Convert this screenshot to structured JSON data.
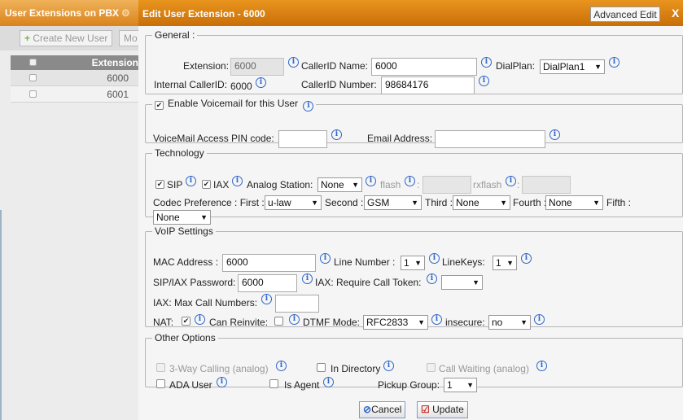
{
  "background": {
    "title": "User Extensions on PBX",
    "create_btn": "Create New User",
    "more_btn": "Mo",
    "table_header": "Extension",
    "rows": [
      "6000",
      "6001"
    ]
  },
  "modal": {
    "title": "Edit User Extension - 6000",
    "advanced_edit": "Advanced Edit",
    "close": "X"
  },
  "general": {
    "legend": "General :",
    "extension_label": "Extension:",
    "extension_value": "6000",
    "callerid_name_label": "CallerID Name:",
    "callerid_name_value": "6000",
    "dialplan_label": "DialPlan:",
    "dialplan_value": "DialPlan1",
    "internal_callerid_label": "Internal CallerID:",
    "internal_callerid_value": "6000",
    "callerid_number_label": "CallerID Number:",
    "callerid_number_value": "98684176"
  },
  "voicemail": {
    "enable_label": "Enable Voicemail for this User",
    "pin_label": "VoiceMail Access PIN code:",
    "pin_value": "",
    "email_label": "Email Address:",
    "email_value": ""
  },
  "technology": {
    "legend": "Technology",
    "sip_label": "SIP",
    "iax_label": "IAX",
    "analog_label": "Analog Station:",
    "analog_value": "None",
    "flash_label": "flash",
    "flash_sep": ":",
    "rxflash_label": "rxflash",
    "codec_label": "Codec Preference : First :",
    "codec_first": "u-law",
    "second_label": "Second :",
    "codec_second": "GSM",
    "third_label": "Third :",
    "codec_third": "None",
    "fourth_label": "Fourth :",
    "codec_fourth": "None",
    "fifth_label": "Fifth :",
    "codec_fifth": "None"
  },
  "voip": {
    "legend": "VoIP Settings",
    "mac_label": "MAC Address :",
    "mac_value": "6000",
    "line_number_label": "Line Number :",
    "line_number_value": "1",
    "linekeys_label": "LineKeys:",
    "linekeys_value": "1",
    "password_label": "SIP/IAX Password:",
    "password_value": "6000",
    "require_token_label": "IAX: Require Call Token:",
    "require_token_value": "",
    "max_calls_label": "IAX: Max Call Numbers:",
    "max_calls_value": "",
    "nat_label": "NAT:",
    "reinvite_label": "Can Reinvite:",
    "dtmf_label": "DTMF Mode:",
    "dtmf_value": "RFC2833",
    "insecure_label": "insecure:",
    "insecure_value": "no"
  },
  "other": {
    "legend": "Other Options",
    "threeway_label": "3-Way Calling (analog)",
    "directory_label": "In Directory",
    "callwaiting_label": "Call Waiting (analog)",
    "ada_label": "ADA User",
    "agent_label": "Is Agent",
    "pickup_label": "Pickup Group:",
    "pickup_value": "1"
  },
  "footer": {
    "cancel": "Cancel",
    "update": "Update"
  },
  "icons": {
    "info": "info-icon",
    "gear": "gear-icon",
    "plus": "plus-icon",
    "cancel": "cancel-icon",
    "update": "update-icon"
  },
  "colors": {
    "header_orange": "#d9831c",
    "info_blue": "#2f66c8"
  }
}
